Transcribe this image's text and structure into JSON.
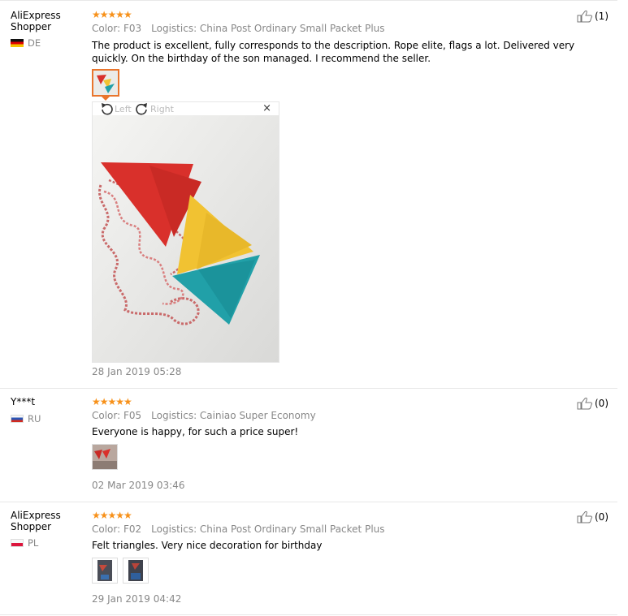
{
  "reviews": [
    {
      "user_line1": "AliExpress",
      "user_line2": "Shopper",
      "country": "DE",
      "stars": "★★★★★",
      "color": "Color: F03",
      "logistics": "Logistics: China Post Ordinary Small Packet Plus",
      "text": "The product is excellent, fully corresponds to the description. Rope elite, flags a lot. Delivered very quickly. On the birthday of the son managed. I recommend the seller.",
      "date": "28 Jan 2019 05:28",
      "likes": "(1)"
    },
    {
      "user_line1": "Y***t",
      "user_line2": "",
      "country": "RU",
      "stars": "★★★★★",
      "color": "Color: F05",
      "logistics": "Logistics: Cainiao Super Economy",
      "text": "Everyone is happy, for such a price super!",
      "date": "02 Mar 2019 03:46",
      "likes": "(0)"
    },
    {
      "user_line1": "AliExpress",
      "user_line2": "Shopper",
      "country": "PL",
      "stars": "★★★★★",
      "color": "Color: F02",
      "logistics": "Logistics: China Post Ordinary Small Packet Plus",
      "text": "Felt triangles. Very nice decoration for birthday",
      "date": "29 Jan 2019 04:42",
      "likes": "(0)"
    }
  ],
  "viewer": {
    "rotate_left": "Left",
    "rotate_right": "Right",
    "close": "×"
  },
  "colors": {
    "star": "#f7911a",
    "active_thumb_border": "#e9752c",
    "flag_red": "#d9302b",
    "flag_yellow": "#f1c232",
    "flag_teal": "#21a0a8"
  },
  "icons": [
    "thumbs-up-icon",
    "rotate-left-icon",
    "rotate-right-icon",
    "close-icon",
    "star-icon"
  ]
}
